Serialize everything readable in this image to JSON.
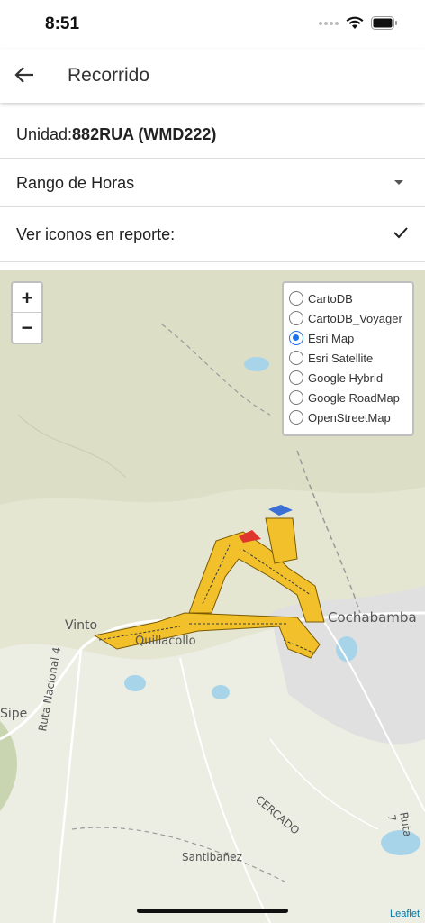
{
  "status": {
    "time": "8:51"
  },
  "app_bar": {
    "title": "Recorrido"
  },
  "unit": {
    "label": "Unidad:",
    "value": "882RUA (WMD222)"
  },
  "range": {
    "label": "Rango de Horas"
  },
  "icons_toggle": {
    "label": "Ver iconos en reporte:",
    "checked": true
  },
  "map": {
    "zoom_in": "+",
    "zoom_out": "−",
    "layers": [
      {
        "label": "CartoDB",
        "selected": false
      },
      {
        "label": "CartoDB_Voyager",
        "selected": false
      },
      {
        "label": "Esri Map",
        "selected": true
      },
      {
        "label": "Esri Satellite",
        "selected": false
      },
      {
        "label": "Google Hybrid",
        "selected": false
      },
      {
        "label": "Google RoadMap",
        "selected": false
      },
      {
        "label": "OpenStreetMap",
        "selected": false
      }
    ],
    "place_labels": {
      "vinto": "Vinto",
      "quillacollo": "Quillacollo",
      "cochabamba": "Cochabamba",
      "sipe": "Sipe",
      "ruta_nacional": "Ruta Nacional 4",
      "cercado": "CERCADO",
      "santibanez": "Santibañez",
      "ruta_7": "Ruta 7"
    },
    "attribution": "Leaflet"
  }
}
